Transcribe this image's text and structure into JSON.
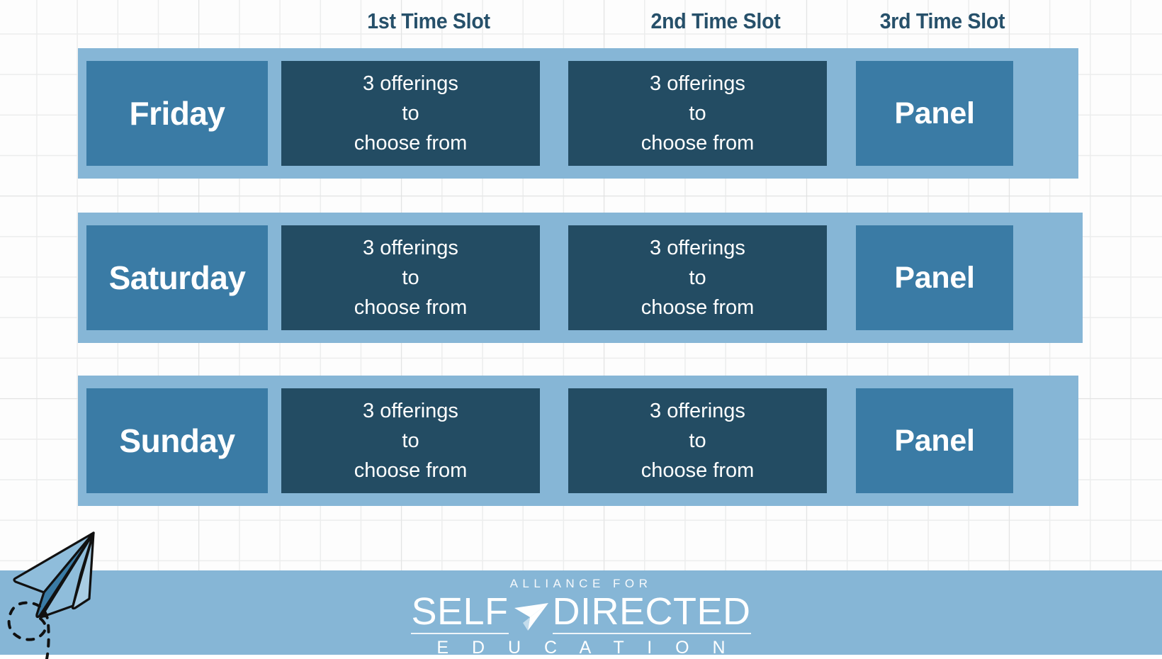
{
  "palette": {
    "band_blue": "#86b6d6",
    "day_blue": "#3a7ba5",
    "slot_navy": "#234c63",
    "header_navy": "#26506a",
    "white": "#ffffff",
    "grid_line": "#eceded",
    "page_bg": "#fdfdfd"
  },
  "headers": [
    {
      "label": "1st Time Slot"
    },
    {
      "label": "2nd Time Slot"
    },
    {
      "label": "3rd Time Slot"
    }
  ],
  "rows": [
    {
      "day": "Friday",
      "slot1": {
        "line1": "3 offerings",
        "line2": "to",
        "line3": "choose from"
      },
      "slot2": {
        "line1": "3 offerings",
        "line2": "to",
        "line3": "choose from"
      },
      "slot3": "Panel"
    },
    {
      "day": "Saturday",
      "slot1": {
        "line1": "3 offerings",
        "line2": "to",
        "line3": "choose from"
      },
      "slot2": {
        "line1": "3 offerings",
        "line2": "to",
        "line3": "choose from"
      },
      "slot3": "Panel"
    },
    {
      "day": "Sunday",
      "slot1": {
        "line1": "3 offerings",
        "line2": "to",
        "line3": "choose from"
      },
      "slot2": {
        "line1": "3 offerings",
        "line2": "to",
        "line3": "choose from"
      },
      "slot3": "Panel"
    }
  ],
  "decoration": {
    "plane_icon": "paper-plane-icon",
    "trail_icon": "dashed-loop-trail-icon"
  },
  "footer": {
    "logo": {
      "tagline": "ALLIANCE FOR",
      "word1": "SELF",
      "word2": "DIRECTED",
      "glyph": "paper-plane-logo-icon",
      "subtitle": "E D U C A T I O N"
    }
  }
}
